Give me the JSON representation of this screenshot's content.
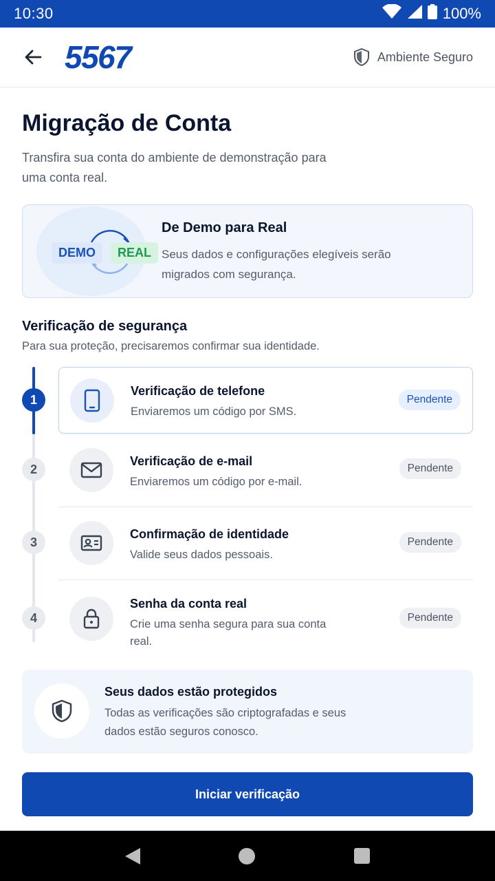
{
  "status_bar": {
    "time": "10:30",
    "battery": "100%"
  },
  "app_bar": {
    "logo": "5567",
    "secure_label": "Ambiente Seguro"
  },
  "page": {
    "title": "Migração de Conta",
    "subtitle": "Transfira sua conta do ambiente de demonstração para uma conta real."
  },
  "demo_card": {
    "badge_demo": "DEMO",
    "badge_real": "REAL",
    "title": "De Demo para Real",
    "description": "Seus dados e configurações elegíveis serão migrados com segurança."
  },
  "security": {
    "title": "Verificação de segurança",
    "description": "Para sua proteção, precisaremos confirmar sua identidade."
  },
  "steps": [
    {
      "number": "1",
      "title": "Verificação de telefone",
      "description": "Enviaremos um código por SMS.",
      "status": "Pendente",
      "icon": "phone-icon"
    },
    {
      "number": "2",
      "title": "Verificação de e-mail",
      "description": "Enviaremos um código por e-mail.",
      "status": "Pendente",
      "icon": "mail-icon"
    },
    {
      "number": "3",
      "title": "Confirmação de identidade",
      "description": "Valide seus dados pessoais.",
      "status": "Pendente",
      "icon": "id-card-icon"
    },
    {
      "number": "4",
      "title": "Senha da conta real",
      "description": "Crie uma senha segura para sua conta real.",
      "status": "Pendente",
      "icon": "lock-icon"
    }
  ],
  "protection": {
    "title": "Seus dados estão protegidos",
    "description": "Todas as verificações são criptografadas e seus dados estão seguros conosco."
  },
  "cta_label": "Iniciar verificação",
  "colors": {
    "primary": "#1149b3",
    "real_green": "#1f9a52"
  }
}
